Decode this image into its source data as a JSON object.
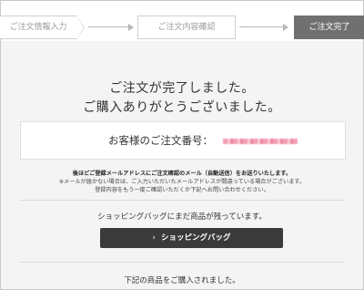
{
  "steps": {
    "step1_label": "ご注文情報入力",
    "step2_label": "ご注文内容確認",
    "step3_label": "ご注文完了"
  },
  "complete": {
    "line1": "ご注文が完了しました。",
    "line2": "ご購入ありがとうございました。"
  },
  "order": {
    "label": "お客様のご注文番号：",
    "number_redacted": true
  },
  "notice": {
    "line1": "後ほどご登録メールアドレスにご注文確認のメール（自動送信）をお送りいたします。",
    "line2": "※メールが届かない場合は、ご入力いただいたメールアドレスが間違っている場合がございます。",
    "line3": "登録内容をもう一度ご確認いただくか下記へお問い合わせください。"
  },
  "bag": {
    "notice": "ショッピングバッグにまだ商品が残っています。",
    "button_label": "ショッピングバッグ",
    "button_icon": "chevron-right-icon"
  },
  "footer": {
    "purchased_text": "下記の商品をご購入されました。"
  },
  "colors": {
    "background": "#f4f4f4",
    "active_step": "#707070",
    "button": "#3a3a3a"
  }
}
